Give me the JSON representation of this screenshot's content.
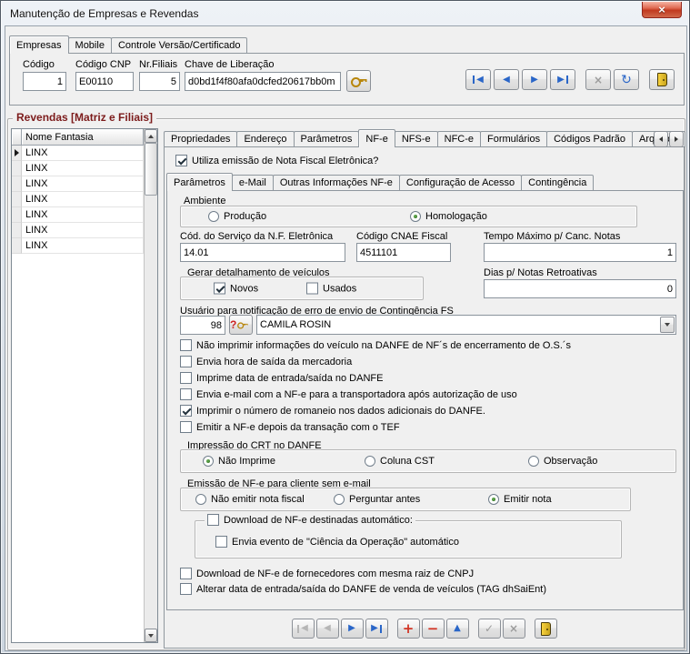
{
  "window": {
    "title": "Manutenção de Empresas e Revendas",
    "close_glyph": "×"
  },
  "main_tabs": [
    {
      "label": "Empresas",
      "active": true
    },
    {
      "label": "Mobile",
      "active": false
    },
    {
      "label": "Controle Versão/Certificado",
      "active": false
    }
  ],
  "empresa": {
    "codigo": {
      "label": "Código",
      "value": "1"
    },
    "codigo_cnp": {
      "label": "Código CNP",
      "value": "E00110"
    },
    "nr_filiais": {
      "label": "Nr.Filiais",
      "value": "5"
    },
    "chave_liberacao": {
      "label": "Chave de Liberação",
      "value": "d0bd1f4f80afa0dcfed20617bb0m"
    }
  },
  "nav_glyphs": {
    "first": "◀",
    "prior": "◀",
    "next": "▶",
    "last": "▶",
    "cancel": "×",
    "refresh": "↻",
    "insert": "+",
    "delete": "−",
    "edit": "▲",
    "post": "✓"
  },
  "revendas": {
    "title": "Revendas [Matriz e Filiais]",
    "grid": {
      "header": "Nome Fantasia",
      "rows": [
        "LINX",
        "LINX",
        "LINX",
        "LINX",
        "LINX",
        "LINX",
        "LINX"
      ]
    },
    "detail_tabs": [
      {
        "label": "Propriedades",
        "active": false
      },
      {
        "label": "Endereço",
        "active": false
      },
      {
        "label": "Parâmetros",
        "active": false
      },
      {
        "label": "NF-e",
        "active": true
      },
      {
        "label": "NFS-e",
        "active": false
      },
      {
        "label": "NFC-e",
        "active": false
      },
      {
        "label": "Formulários",
        "active": false
      },
      {
        "label": "Códigos Padrão",
        "active": false
      },
      {
        "label": "Arquivos",
        "active": false
      }
    ]
  },
  "nfe": {
    "utiliza": {
      "label": "Utiliza emissão de Nota Fiscal Eletrônica?",
      "checked": true
    },
    "sub_tabs": [
      {
        "label": "Parâmetros",
        "active": true
      },
      {
        "label": "e-Mail",
        "active": false
      },
      {
        "label": "Outras Informações NF-e",
        "active": false
      },
      {
        "label": "Configuração de Acesso",
        "active": false
      },
      {
        "label": "Contingência",
        "active": false
      }
    ],
    "ambiente": {
      "label": "Ambiente",
      "producao": {
        "label": "Produção",
        "selected": false
      },
      "homologacao": {
        "label": "Homologação",
        "selected": true
      }
    },
    "cod_servico": {
      "label": "Cód. do Serviço da N.F. Eletrônica",
      "value": "14.01"
    },
    "cnae": {
      "label": "Código CNAE Fiscal",
      "value": "4511101"
    },
    "tempo_max_canc": {
      "label": "Tempo Máximo p/ Canc. Notas",
      "value": "1"
    },
    "detalhamento": {
      "label": "Gerar detalhamento de veículos",
      "novos": {
        "label": "Novos",
        "checked": true
      },
      "usados": {
        "label": "Usados",
        "checked": false
      }
    },
    "dias_retroativas": {
      "label": "Dias p/ Notas Retroativas",
      "value": "0"
    },
    "usuario_contingencia": {
      "label": "Usuário para notificação de erro de envio de Contingência FS",
      "codigo": "98",
      "lookup_glyph": "?",
      "nome": "CAMILA ROSIN"
    },
    "flags": [
      {
        "label": "Não imprimir informações do veículo na DANFE de NF´s de encerramento de O.S.´s",
        "checked": false
      },
      {
        "label": "Envia hora de saída da mercadoria",
        "checked": false
      },
      {
        "label": "Imprime data de entrada/saída no DANFE",
        "checked": false
      },
      {
        "label": "Envia e-mail com a NF-e para a transportadora após autorização de uso",
        "checked": false
      },
      {
        "label": "Imprimir o número de romaneio nos dados adicionais do DANFE.",
        "checked": true
      },
      {
        "label": "Emitir a NF-e depois da transação com o TEF",
        "checked": false
      }
    ],
    "impressao_crt": {
      "label": "Impressão do CRT no DANFE",
      "options": [
        {
          "label": "Não Imprime",
          "selected": true
        },
        {
          "label": "Coluna CST",
          "selected": false
        },
        {
          "label": "Observação",
          "selected": false
        }
      ]
    },
    "emissao_sem_email": {
      "label": "Emissão de NF-e para cliente sem e-mail",
      "options": [
        {
          "label": "Não emitir nota fiscal",
          "selected": false
        },
        {
          "label": "Perguntar antes",
          "selected": false
        },
        {
          "label": "Emitir nota",
          "selected": true
        }
      ]
    },
    "download_destinadas": {
      "label": "Download de NF-e destinadas automático:",
      "checked": false,
      "ciencia": {
        "label": "Envia evento de \"Ciência da Operação\" automático",
        "checked": false
      }
    },
    "download_fornecedores": {
      "label": "Download de NF-e de fornecedores com mesma raiz de CNPJ",
      "checked": false
    },
    "alterar_data_saida": {
      "label": "Alterar data de entrada/saída do DANFE de venda de veículos (TAG dhSaiEnt)",
      "checked": false
    }
  }
}
